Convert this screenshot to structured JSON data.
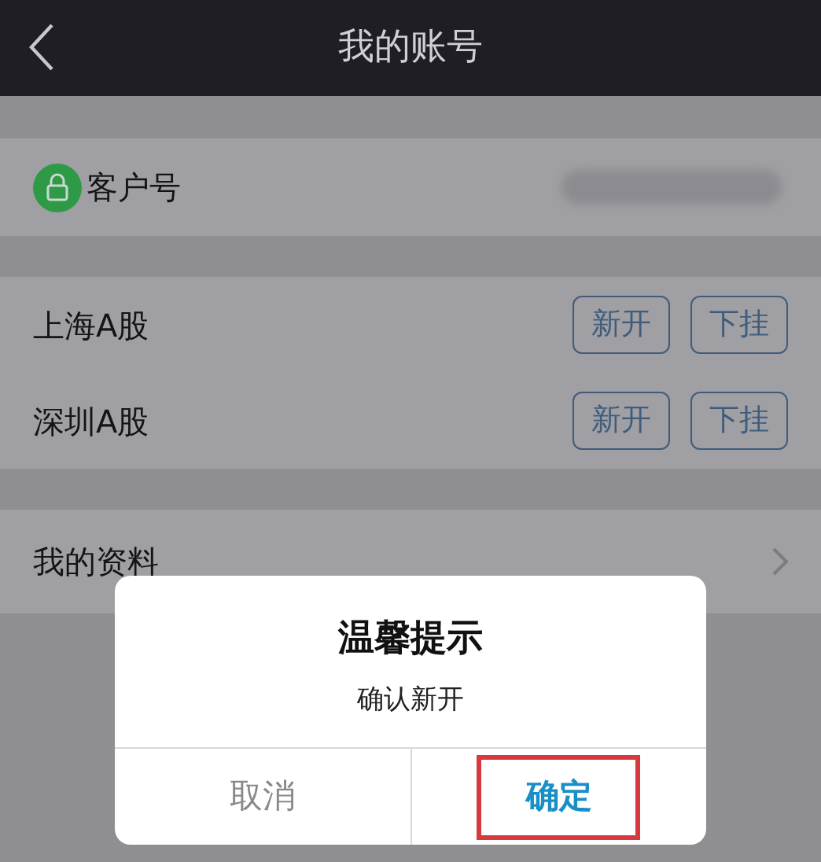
{
  "header": {
    "title": "我的账号"
  },
  "customer": {
    "label": "客户号",
    "value_redacted": true
  },
  "markets": [
    {
      "name": "上海A股",
      "actions": [
        "新开",
        "下挂"
      ]
    },
    {
      "name": "深圳A股",
      "actions": [
        "新开",
        "下挂"
      ]
    }
  ],
  "menu": [
    {
      "label": "我的资料"
    }
  ],
  "dialog": {
    "title": "温馨提示",
    "message": "确认新开",
    "buttons": [
      {
        "label": "取消",
        "kind": "cancel",
        "highlighted": false
      },
      {
        "label": "确定",
        "kind": "confirm",
        "highlighted": true
      }
    ]
  }
}
